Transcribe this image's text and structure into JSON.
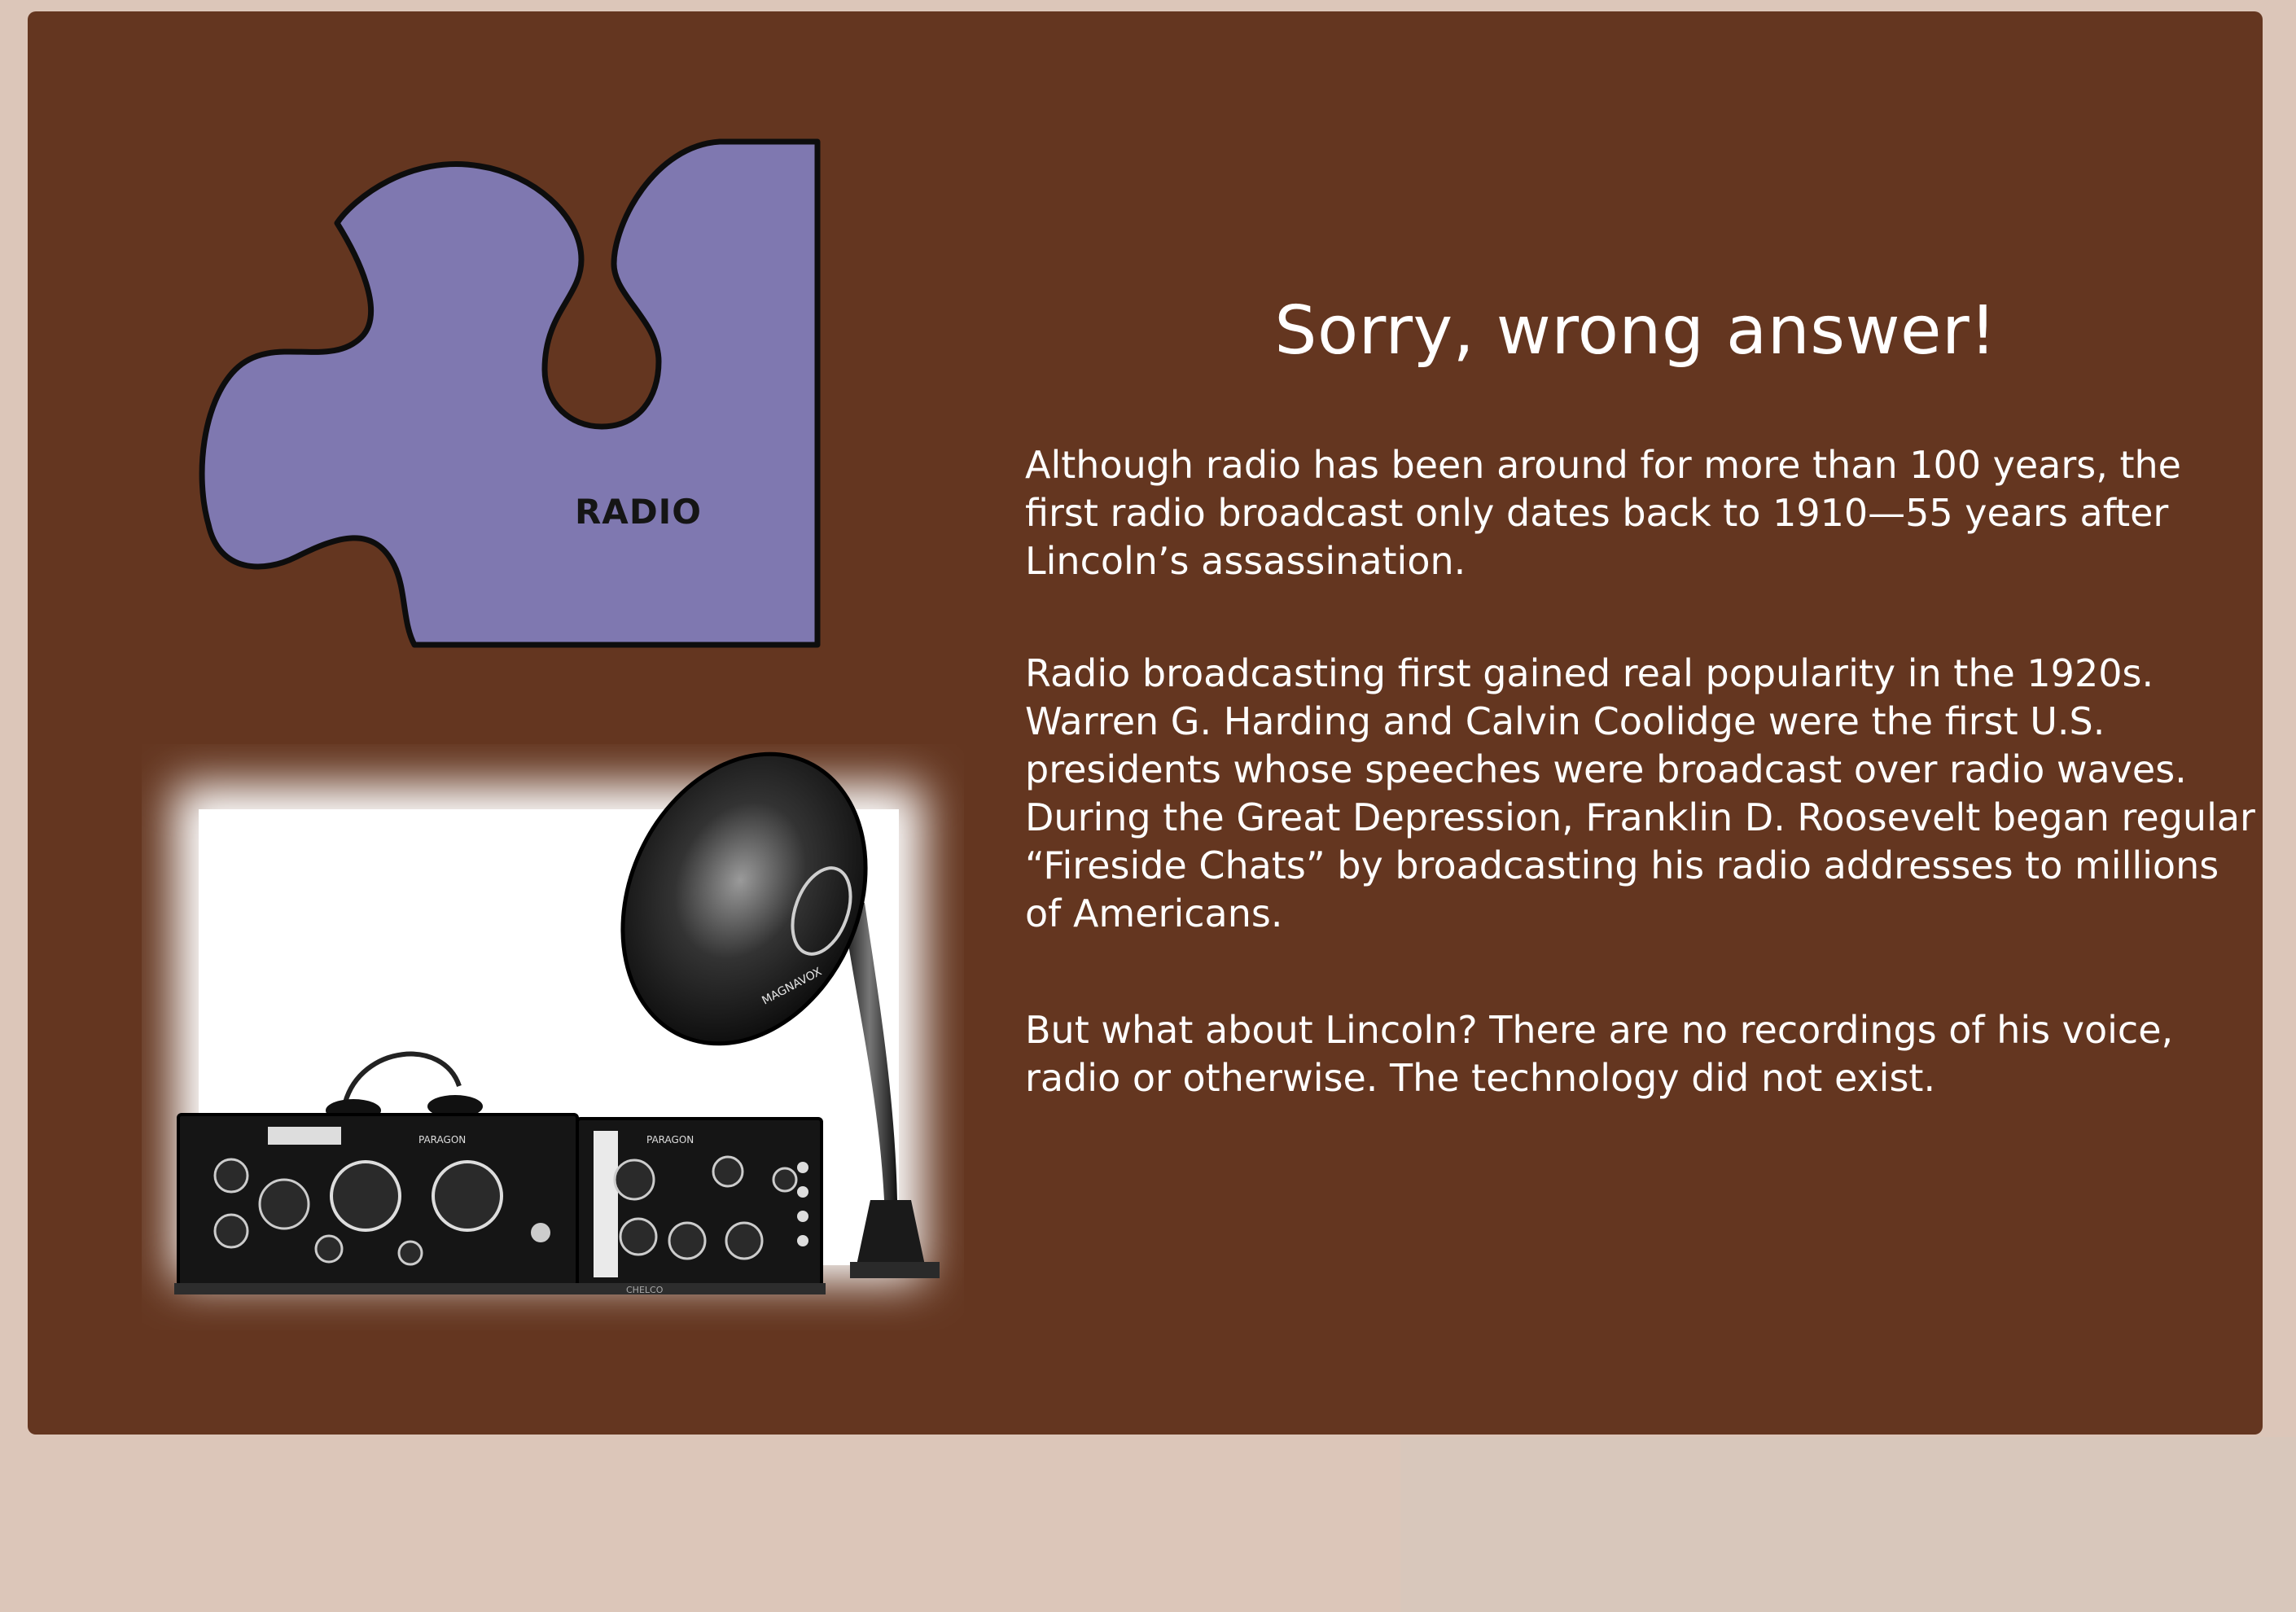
{
  "slide": {
    "heading": "Sorry, wrong answer!",
    "paragraphs": [
      "Although radio has been around for more than 100 years, the first radio broadcast only dates back to 1910—55 years after Lincoln’s assassination.",
      "Radio broadcasting first gained real popularity in the 1920s. Warren G. Harding and Calvin Coolidge were the first U.S. presidents whose speeches were broadcast over radio waves. During the Great Depression, Franklin D. Roosevelt began regular “Fireside Chats” by broadcasting his radio addresses to millions of Americans.",
      "But what about Lincoln? There are no recordings of his voice, radio or otherwise. The technology did not exist."
    ]
  },
  "puzzle_piece": {
    "label": "RADIO",
    "fill_color": "#7f78b0",
    "outline_color": "#0d0d0d"
  },
  "illustration": {
    "subject": "vintage-radio-with-horn-speaker",
    "speaker_brand": "MAGNAVOX",
    "receiver_brand": "PARAGON",
    "base_brand": "CHELCO"
  },
  "colors": {
    "page_background": "#dcc6b9",
    "card_background": "#643620",
    "text": "#ffffff"
  }
}
